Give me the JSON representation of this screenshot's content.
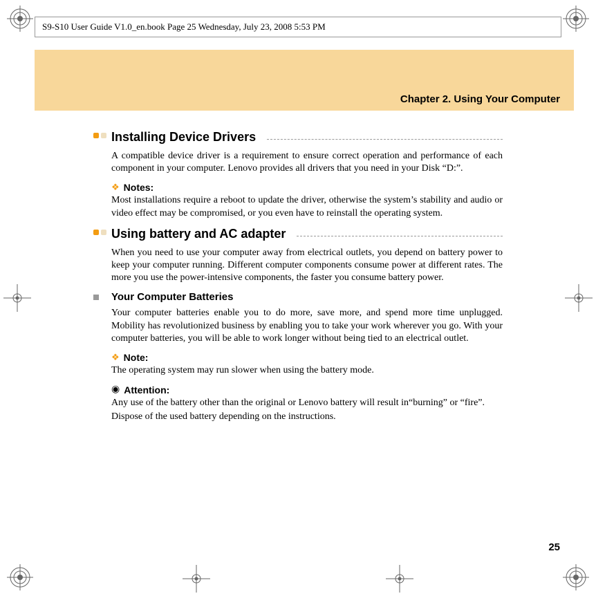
{
  "header": "S9-S10 User Guide V1.0_en.book  Page 25  Wednesday, July 23, 2008  5:53 PM",
  "chapter_title": "Chapter 2. Using Your Computer",
  "section1": {
    "title": "Installing Device Drivers",
    "para1": "A compatible device driver is a requirement to ensure correct operation and performance of each component in your computer. Lenovo provides all drivers that you need in your Disk “D:”.",
    "notes_label": "Notes:",
    "notes_text": "Most installations require a reboot to update the driver, otherwise the system’s stability and audio or video effect may be compromised, or you even have to reinstall the operating system."
  },
  "section2": {
    "title": "Using battery and AC adapter",
    "para1": "When you need to use your computer away from electrical outlets, you depend on battery power to keep your computer running. Different computer components consume power at different rates. The more you use the power-intensive components, the faster you consume battery power."
  },
  "subsection": {
    "title": "Your Computer Batteries",
    "para1": "Your computer batteries enable you to do more, save more, and spend more time unplugged. Mobility has revolutionized business by enabling you to take your work wherever you go. With your computer batteries, you will be able to work longer without being tied to an electrical outlet.",
    "note_label": "Note:",
    "note_text": "The operating system may run slower when using the battery mode.",
    "attention_label": "Attention:",
    "attention_text1": "Any use of the battery other than the original or Lenovo battery will result in“burning” or “fire”.",
    "attention_text2": "Dispose of the used battery depending on the instructions."
  },
  "page_number": "25"
}
